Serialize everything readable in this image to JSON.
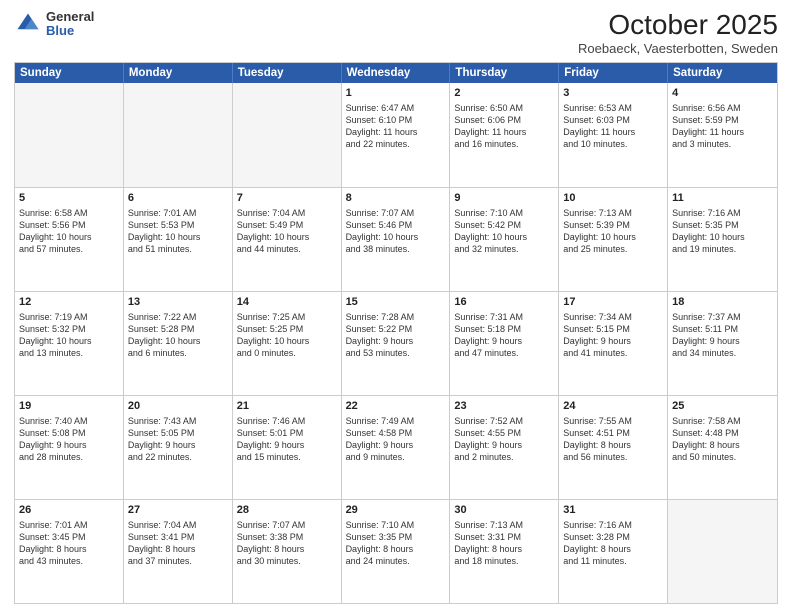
{
  "logo": {
    "general": "General",
    "blue": "Blue"
  },
  "header": {
    "month": "October 2025",
    "location": "Roebaeck, Vaesterbotten, Sweden"
  },
  "days": [
    "Sunday",
    "Monday",
    "Tuesday",
    "Wednesday",
    "Thursday",
    "Friday",
    "Saturday"
  ],
  "weeks": [
    [
      {
        "day": "",
        "info": ""
      },
      {
        "day": "",
        "info": ""
      },
      {
        "day": "",
        "info": ""
      },
      {
        "day": "1",
        "info": "Sunrise: 6:47 AM\nSunset: 6:10 PM\nDaylight: 11 hours\nand 22 minutes."
      },
      {
        "day": "2",
        "info": "Sunrise: 6:50 AM\nSunset: 6:06 PM\nDaylight: 11 hours\nand 16 minutes."
      },
      {
        "day": "3",
        "info": "Sunrise: 6:53 AM\nSunset: 6:03 PM\nDaylight: 11 hours\nand 10 minutes."
      },
      {
        "day": "4",
        "info": "Sunrise: 6:56 AM\nSunset: 5:59 PM\nDaylight: 11 hours\nand 3 minutes."
      }
    ],
    [
      {
        "day": "5",
        "info": "Sunrise: 6:58 AM\nSunset: 5:56 PM\nDaylight: 10 hours\nand 57 minutes."
      },
      {
        "day": "6",
        "info": "Sunrise: 7:01 AM\nSunset: 5:53 PM\nDaylight: 10 hours\nand 51 minutes."
      },
      {
        "day": "7",
        "info": "Sunrise: 7:04 AM\nSunset: 5:49 PM\nDaylight: 10 hours\nand 44 minutes."
      },
      {
        "day": "8",
        "info": "Sunrise: 7:07 AM\nSunset: 5:46 PM\nDaylight: 10 hours\nand 38 minutes."
      },
      {
        "day": "9",
        "info": "Sunrise: 7:10 AM\nSunset: 5:42 PM\nDaylight: 10 hours\nand 32 minutes."
      },
      {
        "day": "10",
        "info": "Sunrise: 7:13 AM\nSunset: 5:39 PM\nDaylight: 10 hours\nand 25 minutes."
      },
      {
        "day": "11",
        "info": "Sunrise: 7:16 AM\nSunset: 5:35 PM\nDaylight: 10 hours\nand 19 minutes."
      }
    ],
    [
      {
        "day": "12",
        "info": "Sunrise: 7:19 AM\nSunset: 5:32 PM\nDaylight: 10 hours\nand 13 minutes."
      },
      {
        "day": "13",
        "info": "Sunrise: 7:22 AM\nSunset: 5:28 PM\nDaylight: 10 hours\nand 6 minutes."
      },
      {
        "day": "14",
        "info": "Sunrise: 7:25 AM\nSunset: 5:25 PM\nDaylight: 10 hours\nand 0 minutes."
      },
      {
        "day": "15",
        "info": "Sunrise: 7:28 AM\nSunset: 5:22 PM\nDaylight: 9 hours\nand 53 minutes."
      },
      {
        "day": "16",
        "info": "Sunrise: 7:31 AM\nSunset: 5:18 PM\nDaylight: 9 hours\nand 47 minutes."
      },
      {
        "day": "17",
        "info": "Sunrise: 7:34 AM\nSunset: 5:15 PM\nDaylight: 9 hours\nand 41 minutes."
      },
      {
        "day": "18",
        "info": "Sunrise: 7:37 AM\nSunset: 5:11 PM\nDaylight: 9 hours\nand 34 minutes."
      }
    ],
    [
      {
        "day": "19",
        "info": "Sunrise: 7:40 AM\nSunset: 5:08 PM\nDaylight: 9 hours\nand 28 minutes."
      },
      {
        "day": "20",
        "info": "Sunrise: 7:43 AM\nSunset: 5:05 PM\nDaylight: 9 hours\nand 22 minutes."
      },
      {
        "day": "21",
        "info": "Sunrise: 7:46 AM\nSunset: 5:01 PM\nDaylight: 9 hours\nand 15 minutes."
      },
      {
        "day": "22",
        "info": "Sunrise: 7:49 AM\nSunset: 4:58 PM\nDaylight: 9 hours\nand 9 minutes."
      },
      {
        "day": "23",
        "info": "Sunrise: 7:52 AM\nSunset: 4:55 PM\nDaylight: 9 hours\nand 2 minutes."
      },
      {
        "day": "24",
        "info": "Sunrise: 7:55 AM\nSunset: 4:51 PM\nDaylight: 8 hours\nand 56 minutes."
      },
      {
        "day": "25",
        "info": "Sunrise: 7:58 AM\nSunset: 4:48 PM\nDaylight: 8 hours\nand 50 minutes."
      }
    ],
    [
      {
        "day": "26",
        "info": "Sunrise: 7:01 AM\nSunset: 3:45 PM\nDaylight: 8 hours\nand 43 minutes."
      },
      {
        "day": "27",
        "info": "Sunrise: 7:04 AM\nSunset: 3:41 PM\nDaylight: 8 hours\nand 37 minutes."
      },
      {
        "day": "28",
        "info": "Sunrise: 7:07 AM\nSunset: 3:38 PM\nDaylight: 8 hours\nand 30 minutes."
      },
      {
        "day": "29",
        "info": "Sunrise: 7:10 AM\nSunset: 3:35 PM\nDaylight: 8 hours\nand 24 minutes."
      },
      {
        "day": "30",
        "info": "Sunrise: 7:13 AM\nSunset: 3:31 PM\nDaylight: 8 hours\nand 18 minutes."
      },
      {
        "day": "31",
        "info": "Sunrise: 7:16 AM\nSunset: 3:28 PM\nDaylight: 8 hours\nand 11 minutes."
      },
      {
        "day": "",
        "info": ""
      }
    ]
  ]
}
